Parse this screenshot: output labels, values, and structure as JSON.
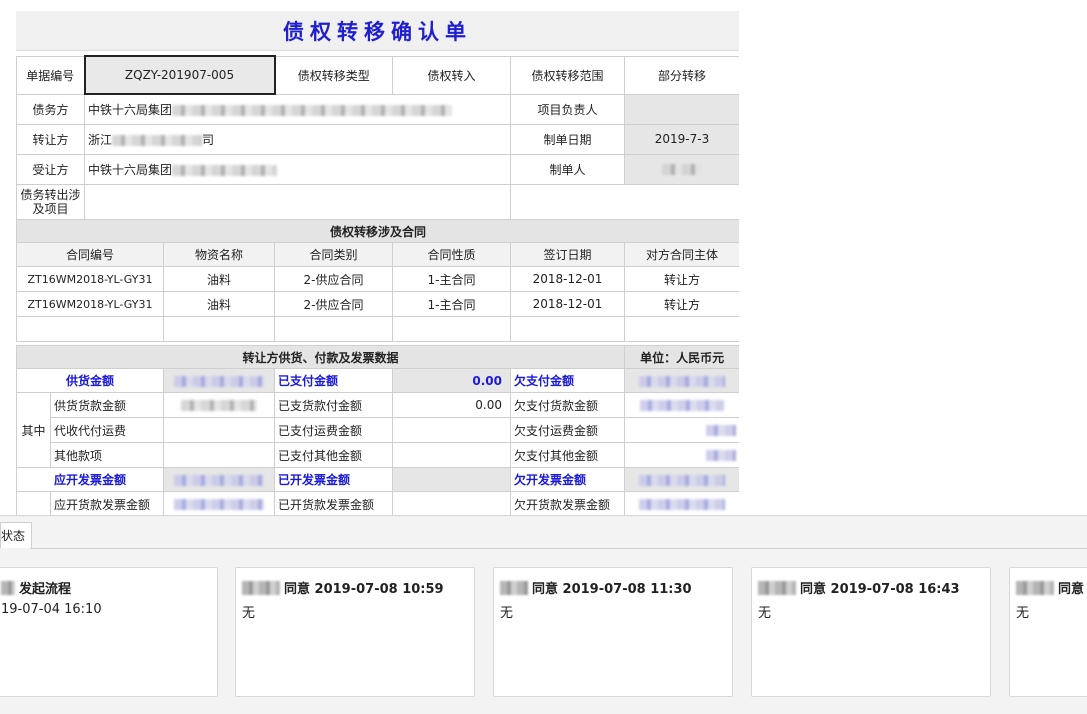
{
  "form": {
    "title": "债权转移确认单",
    "header": {
      "doc_no_label": "单据编号",
      "doc_no_value": "ZQZY-201907-005",
      "type_label": "债权转移类型",
      "type_value": "债权转入",
      "scope_label": "债权转移范围",
      "scope_value": "部分转移",
      "debtor_label": "债务方",
      "debtor_value": "中铁十六局集团",
      "project_lead_label": "项目负责人",
      "transferor_label": "转让方",
      "transferor_prefix": "浙江",
      "transferor_suffix": "司",
      "date_label": "制单日期",
      "date_value": "2019-7-3",
      "transferee_label": "受让方",
      "transferee_value": "中铁十六局集团",
      "maker_label": "制单人",
      "project_label": "债务转出涉及项目"
    },
    "contracts": {
      "title": "债权转移涉及合同",
      "columns": [
        "合同编号",
        "物资名称",
        "合同类别",
        "合同性质",
        "签订日期",
        "对方合同主体"
      ],
      "rows": [
        [
          "ZT16WM2018-YL-GY31",
          "油料",
          "2-供应合同",
          "1-主合同",
          "2018-12-01",
          "转让方"
        ],
        [
          "ZT16WM2018-YL-GY31",
          "油料",
          "2-供应合同",
          "1-主合同",
          "2018-12-01",
          "转让方"
        ]
      ]
    },
    "payments": {
      "title": "转让方供货、付款及发票数据",
      "unit": "单位：人民币元",
      "supply_total": "供货金额",
      "paid_total": "已支付金额",
      "paid_total_value": "0.00",
      "owed_total": "欠支付金额",
      "of_which": "其中",
      "supply_goods": "供货货款金额",
      "paid_goods": "已支货款付金额",
      "paid_goods_value": "0.00",
      "owed_goods": "欠支付货款金额",
      "collect_freight": "代收代付运费",
      "paid_freight": "已支付运费金额",
      "owed_freight": "欠支付运费金额",
      "other": "其他款项",
      "paid_other": "已支付其他金额",
      "owed_other": "欠支付其他金额",
      "invoice_due": "应开发票金额",
      "invoice_done": "已开发票金额",
      "invoice_owed": "欠开发票金额",
      "invoice_goods_due": "应开货款发票金额",
      "invoice_goods_done": "已开货款发票金额",
      "invoice_goods_owed": "欠开货款发票金额"
    }
  },
  "status_panel": {
    "tab_label": "状态",
    "cards": [
      {
        "head": "发起流程",
        "sub": "19-07-04 16:10"
      },
      {
        "head": "同意 2019-07-08 10:59",
        "sub": "无"
      },
      {
        "head": "同意 2019-07-08 11:30",
        "sub": "无"
      },
      {
        "head": "同意 2019-07-08 16:43",
        "sub": "无"
      },
      {
        "head": "同意",
        "sub": "无"
      }
    ]
  },
  "colors": {
    "accent_blue": "#1a1ad8",
    "title_blue": "#1f1fd0"
  }
}
